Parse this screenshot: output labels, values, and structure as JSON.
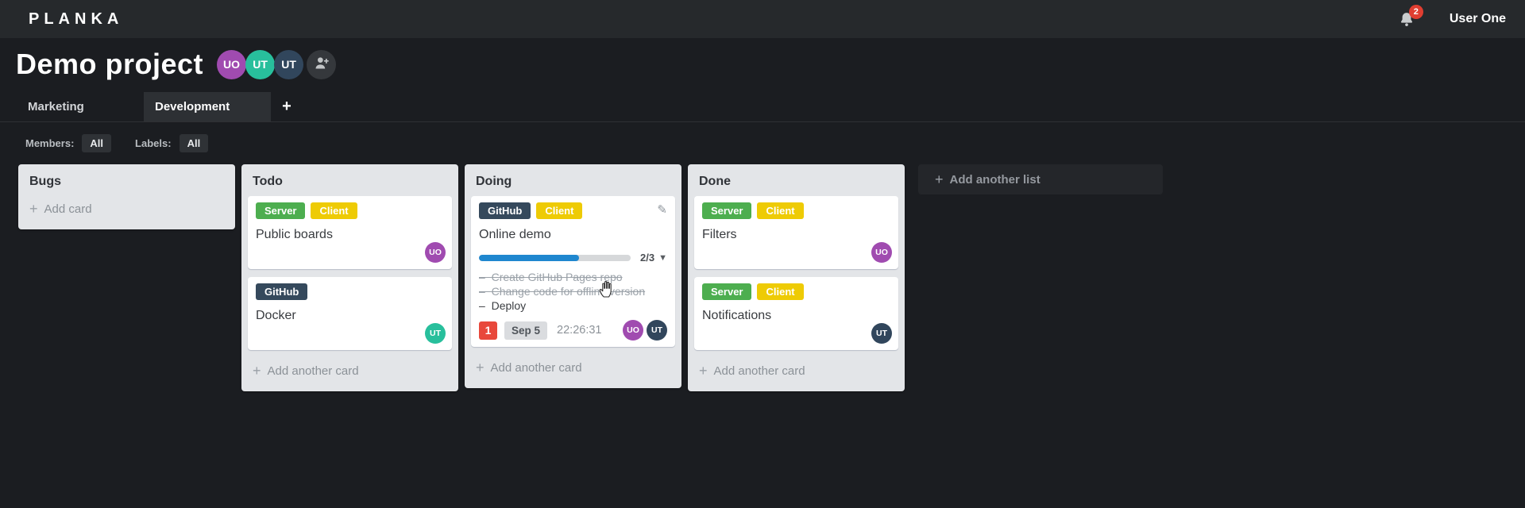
{
  "colors": {
    "topbar_bg": "#26292c",
    "board_bg": "#1b1d21",
    "list_bg": "#e3e5e8",
    "progress_blue": "#1f87cf",
    "label_green": "#4dae4f",
    "label_yellow": "#eecb05",
    "label_navy": "#35495c",
    "notification_red": "#e03e31",
    "due_count_red": "#e8483b",
    "avatar_purple": "#a04bb0",
    "avatar_teal": "#28bf9c",
    "avatar_navy": "#31465c"
  },
  "topbar": {
    "logo": "PLANKA",
    "notification_count": "2",
    "user_name": "User One"
  },
  "header": {
    "title": "Demo project",
    "members": [
      {
        "initials": "UO",
        "color": "purple"
      },
      {
        "initials": "UT",
        "color": "teal"
      },
      {
        "initials": "UT",
        "color": "navy"
      }
    ]
  },
  "tabs": {
    "items": [
      {
        "label": "Marketing",
        "active": false
      },
      {
        "label": "Development",
        "active": true
      }
    ],
    "add_label": "+"
  },
  "filters": {
    "members_label": "Members:",
    "members_value": "All",
    "labels_label": "Labels:",
    "labels_value": "All"
  },
  "board": {
    "add_list_label": "Add another list",
    "lists": [
      {
        "title": "Bugs",
        "add_label": "Add card",
        "cards": []
      },
      {
        "title": "Todo",
        "add_label": "Add another card",
        "cards": [
          {
            "title": "Public boards",
            "labels": [
              {
                "name": "Server",
                "color": "green"
              },
              {
                "name": "Client",
                "color": "yellow"
              }
            ],
            "members": [
              {
                "initials": "UO",
                "color": "purple"
              }
            ]
          },
          {
            "title": "Docker",
            "labels": [
              {
                "name": "GitHub",
                "color": "navy"
              }
            ],
            "members": [
              {
                "initials": "UT",
                "color": "teal"
              }
            ]
          }
        ]
      },
      {
        "title": "Doing",
        "add_label": "Add another card",
        "cards": [
          {
            "title": "Online demo",
            "labels": [
              {
                "name": "GitHub",
                "color": "navy"
              },
              {
                "name": "Client",
                "color": "yellow"
              }
            ],
            "progress": {
              "completed": 2,
              "total": 3,
              "text": "2/3",
              "percent": 66
            },
            "tasks": [
              {
                "text": "Create GitHub Pages repo",
                "done": true
              },
              {
                "text": "Change code for offline version",
                "done": true
              },
              {
                "text": "Deploy",
                "done": false
              }
            ],
            "due_count": "1",
            "due_date": "Sep 5",
            "timer": "22:26:31",
            "members": [
              {
                "initials": "UO",
                "color": "purple"
              },
              {
                "initials": "UT",
                "color": "navy"
              }
            ]
          }
        ]
      },
      {
        "title": "Done",
        "add_label": "Add another card",
        "cards": [
          {
            "title": "Filters",
            "labels": [
              {
                "name": "Server",
                "color": "green"
              },
              {
                "name": "Client",
                "color": "yellow"
              }
            ],
            "members": [
              {
                "initials": "UO",
                "color": "purple"
              }
            ]
          },
          {
            "title": "Notifications",
            "labels": [
              {
                "name": "Server",
                "color": "green"
              },
              {
                "name": "Client",
                "color": "yellow"
              }
            ],
            "members": [
              {
                "initials": "UT",
                "color": "navy"
              }
            ]
          }
        ]
      }
    ]
  }
}
